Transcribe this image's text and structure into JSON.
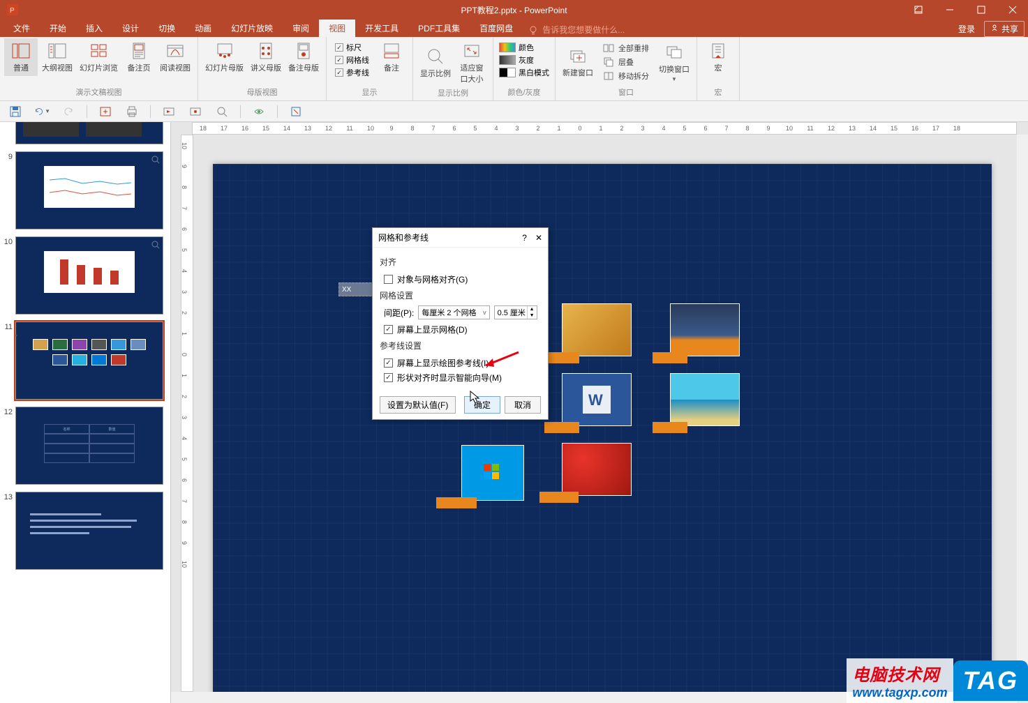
{
  "title": "PPT教程2.pptx - PowerPoint",
  "win_buttons": {
    "display_options": "⊡",
    "minimize": "—",
    "maximize": "☐",
    "close": "✕"
  },
  "tabs": {
    "file": "文件",
    "home": "开始",
    "insert": "插入",
    "design": "设计",
    "transitions": "切换",
    "animations": "动画",
    "slideshow": "幻灯片放映",
    "review": "审阅",
    "view": "视图",
    "developer": "开发工具",
    "pdf": "PDF工具集",
    "baidu": "百度网盘"
  },
  "tell_me": "告诉我您想要做什么...",
  "signin": "登录",
  "share": "共享",
  "ribbon": {
    "views": {
      "normal": "普通",
      "outline": "大纲视图",
      "sorter": "幻灯片浏览",
      "notes_page": "备注页",
      "reading": "阅读视图",
      "group": "演示文稿视图"
    },
    "master": {
      "slide": "幻灯片母版",
      "handout": "讲义母版",
      "notes": "备注母版",
      "group": "母版视图"
    },
    "show": {
      "ruler": "标尺",
      "gridlines": "网格线",
      "guides": "参考线",
      "notes": "备注",
      "group": "显示"
    },
    "zoom": {
      "zoom": "显示比例",
      "fit": "适应窗口大小",
      "group": "显示比例"
    },
    "colorg": {
      "color": "颜色",
      "gray": "灰度",
      "bw": "黑白模式",
      "group": "颜色/灰度"
    },
    "window": {
      "new": "新建窗口",
      "arrange": "全部重排",
      "cascade": "层叠",
      "split": "移动拆分",
      "switch": "切换窗口",
      "group": "窗口"
    },
    "macros": {
      "macros": "宏",
      "group": "宏"
    },
    "checked": {
      "ruler": true,
      "gridlines": true,
      "guides": true
    }
  },
  "ruler_h": [
    "18",
    "17",
    "16",
    "15",
    "14",
    "13",
    "12",
    "11",
    "10",
    "9",
    "8",
    "7",
    "6",
    "5",
    "4",
    "3",
    "2",
    "1",
    "0",
    "1",
    "2",
    "3",
    "4",
    "5",
    "6",
    "7",
    "8",
    "9",
    "10",
    "11",
    "12",
    "13",
    "14",
    "15",
    "16",
    "17",
    "18"
  ],
  "ruler_v": [
    "10",
    "9",
    "8",
    "7",
    "6",
    "5",
    "4",
    "3",
    "2",
    "1",
    "0",
    "1",
    "2",
    "3",
    "4",
    "5",
    "6",
    "7",
    "8",
    "9",
    "10"
  ],
  "thumbs": {
    "n9": "9",
    "n10": "10",
    "n11": "11",
    "n12": "12",
    "n13": "13",
    "star": "*"
  },
  "slide_label_visible": "XX",
  "dialog": {
    "title": "网格和参考线",
    "help": "?",
    "close": "✕",
    "align_section": "对齐",
    "snap_to_grid": "对象与网格对齐(G)",
    "grid_section": "网格设置",
    "spacing_label": "间距(P):",
    "spacing_select": "每厘米 2 个网格",
    "spacing_value": "0.5 厘米",
    "show_grid": "屏幕上显示网格(D)",
    "guides_section": "参考线设置",
    "show_guides": "屏幕上显示绘图参考线(I)",
    "smart_guides": "形状对齐时显示智能向导(M)",
    "set_default": "设置为默认值(F)",
    "ok": "确定",
    "cancel": "取消",
    "checked": {
      "snap": false,
      "show_grid": true,
      "show_guides": true,
      "smart_guides": true
    }
  },
  "watermark": {
    "cn": "电脑技术网",
    "url": "www.tagxp.com",
    "tag": "TAG"
  }
}
